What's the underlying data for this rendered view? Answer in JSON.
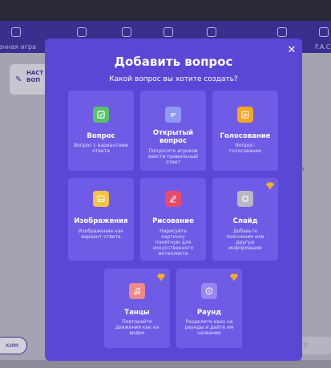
{
  "background": {
    "nav_left_label": "енная игра",
    "nav_right_label": "F.A.C",
    "sidebar_text_line1": "НАСТ",
    "sidebar_text_line2": "ВОП",
    "right_letter": "а",
    "left_button_label": "ким",
    "right_button_label": "тр"
  },
  "modal": {
    "title": "Добавить вопрос",
    "subtitle": "Какой вопрос вы хотите создать?",
    "close_glyph": "✕",
    "cards": [
      {
        "title": "Вопрос",
        "desc": "Вопрос с вариантами ответа",
        "icon": "checkbox-icon",
        "icon_color": "#5ac16b",
        "premium": false
      },
      {
        "title": "Открытый вопрос",
        "desc": "Попросите игроков ввести правильный ответ",
        "icon": "text-lines-icon",
        "icon_color": "#8f9bf2",
        "premium": false
      },
      {
        "title": "Голосование",
        "desc": "Вопрос-голосование",
        "icon": "bar-chart-icon",
        "icon_color": "#f5a623",
        "premium": false
      },
      {
        "title": "Изображения",
        "desc": "Изображение как вариант ответа",
        "icon": "image-icon",
        "icon_color": "#f5c342",
        "premium": false
      },
      {
        "title": "Рисование",
        "desc": "Нарисуйте картинку понятную для искусственного интеллекта",
        "icon": "pencil-icon",
        "icon_color": "#e84a6a",
        "premium": false
      },
      {
        "title": "Слайд",
        "desc": "Добавьте пояснение или другую информацию",
        "icon": "slide-icon",
        "icon_color": "#b9b9c6",
        "premium": true
      },
      {
        "title": "Танцы",
        "desc": "Повторейте движения как на видео",
        "icon": "music-note-icon",
        "icon_color": "#f08a8a",
        "premium": true
      },
      {
        "title": "Раунд",
        "desc": "Разделите квиз на раунды и дайте им название",
        "icon": "round-badge-icon",
        "icon_color": "#9b86f0",
        "premium": true
      }
    ]
  },
  "colors": {
    "modal_bg": "#5b47d6",
    "card_bg": "#6f5ce6",
    "premium_diamond": "#f5a623"
  }
}
